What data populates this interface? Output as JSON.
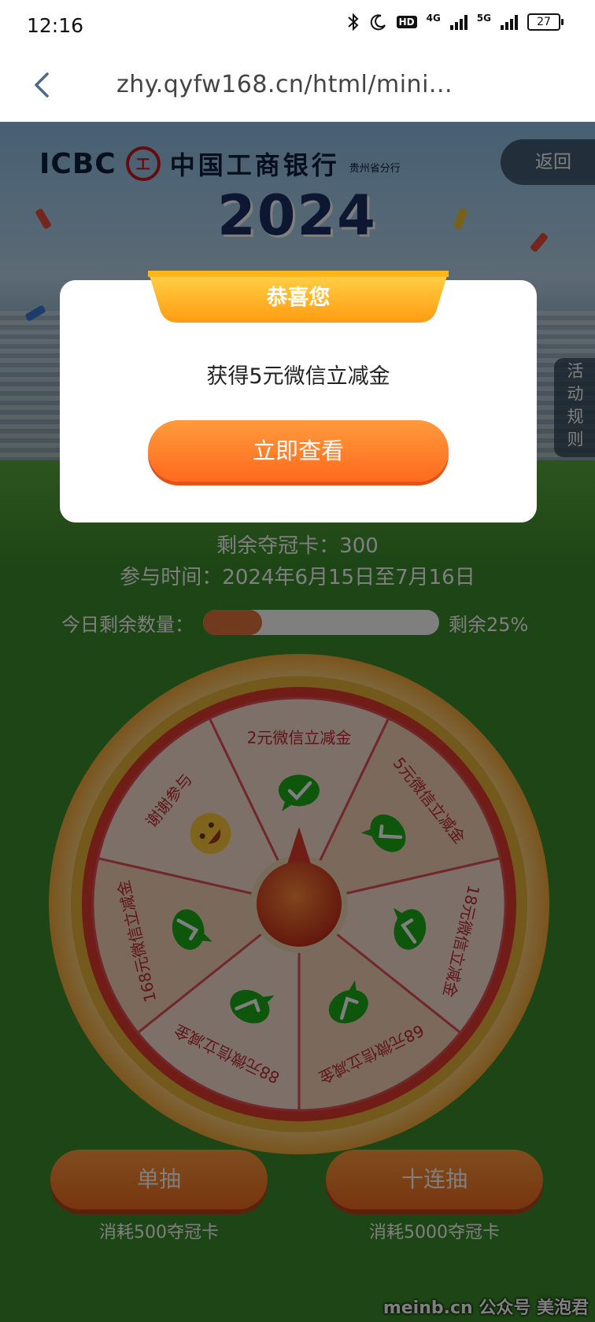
{
  "status_bar": {
    "time": "12:16",
    "net1": "4G",
    "net2": "5G",
    "hd": "HD",
    "battery": "27"
  },
  "url_bar": {
    "url": "zhy.qyfw168.cn/html/mini..."
  },
  "banner": {
    "logo_en": "ICBC",
    "seal_glyph": "工",
    "logo_cn": "中国工商银行",
    "branch": "贵州省分行",
    "year": "2024",
    "back_label": "返回",
    "rules_label": "活动规则"
  },
  "info": {
    "cards_remaining": "剩余夺冠卡：300",
    "period": "参与时间：2024年6月15日至7月16日",
    "today_label": "今日剩余数量：",
    "today_percent": "剩余25%",
    "today_fraction": 0.25
  },
  "wheel": {
    "segments": [
      "2元微信立减金",
      "5元微信立减金",
      "18元微信立减金",
      "68元微信立减金",
      "88元微信立减金",
      "168元微信立减金",
      "谢谢参与"
    ]
  },
  "actions": {
    "single_label": "单抽",
    "ten_label": "十连抽",
    "single_cost": "消耗500夺冠卡",
    "ten_cost": "消耗5000夺冠卡"
  },
  "dialog": {
    "title": "恭喜您",
    "message": "获得5元微信立减金",
    "button": "立即查看"
  },
  "watermark": "meinb.cn 公众号 美泡君",
  "colors": {
    "accent_orange": "#ff7a22",
    "ribbon_yellow": "#ffb619",
    "wheel_red": "#d9282f",
    "wechat_green": "#1aad19",
    "page_green": "#3b8a2a"
  }
}
